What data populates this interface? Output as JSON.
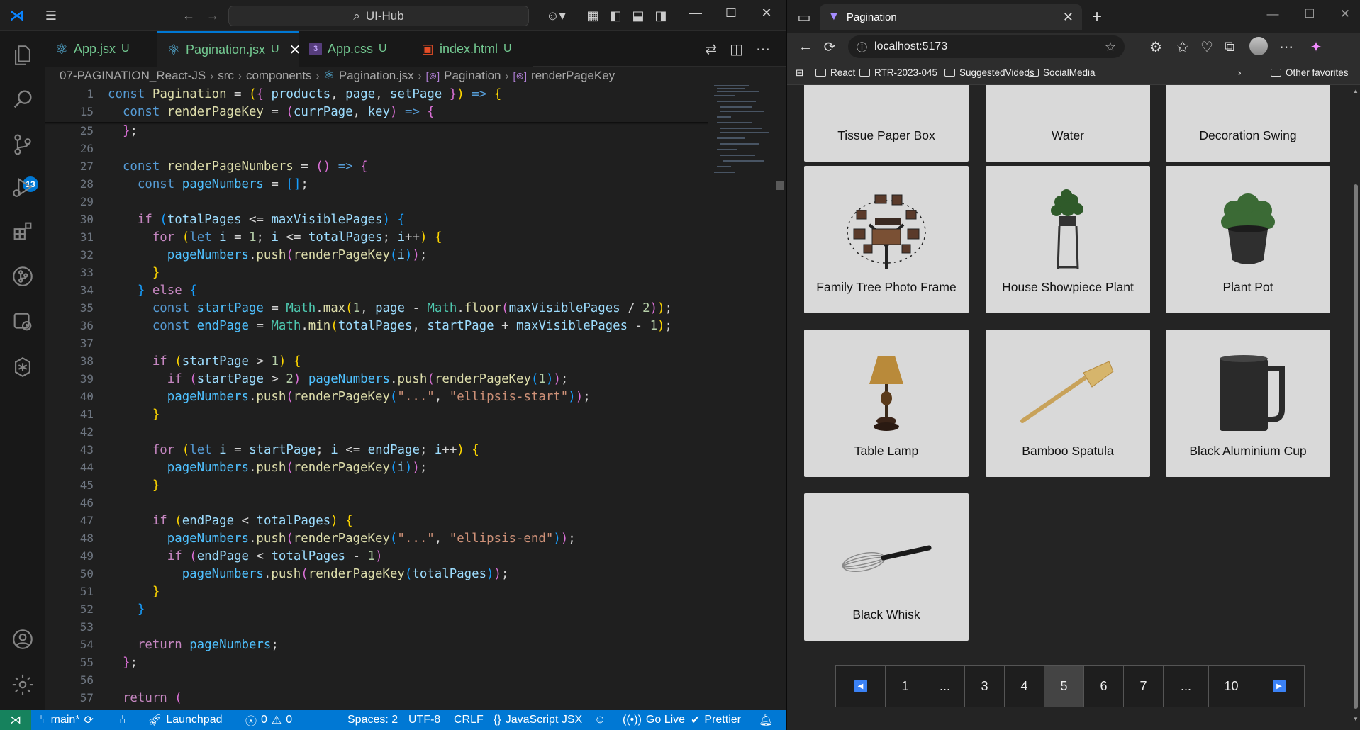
{
  "vscode": {
    "search_label": "UI-Hub",
    "tabs": [
      {
        "name": "App.jsx",
        "status": "U",
        "icon": "react-icon"
      },
      {
        "name": "Pagination.jsx",
        "status": "U",
        "icon": "react-icon"
      },
      {
        "name": "App.css",
        "status": "U",
        "icon": "css-icon"
      },
      {
        "name": "index.html",
        "status": "U",
        "icon": "html-icon"
      }
    ],
    "breadcrumb": [
      "07-PAGINATION_React-JS",
      "src",
      "components",
      "Pagination.jsx",
      "Pagination",
      "renderPageKey"
    ],
    "scm_badge": "13",
    "line_numbers": [
      "1",
      "15",
      "25",
      "26",
      "27",
      "28",
      "29",
      "30",
      "31",
      "32",
      "33",
      "34",
      "35",
      "36",
      "37",
      "38",
      "39",
      "40",
      "41",
      "42",
      "43",
      "44",
      "45",
      "46",
      "47",
      "48",
      "49",
      "50",
      "51",
      "52",
      "53",
      "54",
      "55",
      "56",
      "57"
    ],
    "status": {
      "branch": "main*",
      "launchpad": "Launchpad",
      "problems": "0",
      "warnings": "0",
      "spaces": "Spaces: 2",
      "encoding": "UTF-8",
      "eol": "CRLF",
      "language": "JavaScript JSX",
      "golive": "Go Live",
      "prettier": "Prettier"
    }
  },
  "browser": {
    "tab_title": "Pagination",
    "url": "localhost:5173",
    "bookmarks": [
      "React",
      "RTR-2023-045",
      "SuggestedVideos",
      "SocialMedia"
    ],
    "other_favorites": "Other favorites",
    "products_top": [
      "Tissue Paper Box",
      "Water",
      "Decoration Swing"
    ],
    "products": [
      "Family Tree Photo Frame",
      "House Showpiece Plant",
      "Plant Pot",
      "Table Lamp",
      "Bamboo Spatula",
      "Black Aluminium Cup",
      "Black Whisk"
    ],
    "pagination": [
      "1",
      "...",
      "3",
      "4",
      "5",
      "6",
      "7",
      "...",
      "10"
    ],
    "current_page": "5"
  }
}
